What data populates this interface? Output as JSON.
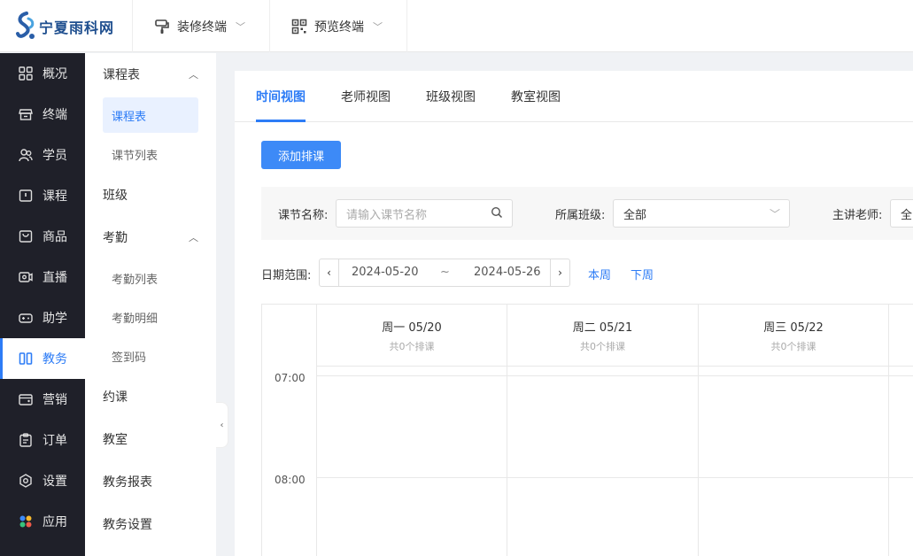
{
  "brand": {
    "name": "宁夏雨科网"
  },
  "topnav": [
    {
      "label": "装修终端",
      "icon": "brush-icon"
    },
    {
      "label": "预览终端",
      "icon": "qrcode-icon"
    }
  ],
  "sidebar": {
    "items": [
      {
        "label": "概况",
        "icon": "dashboard-icon"
      },
      {
        "label": "终端",
        "icon": "store-icon"
      },
      {
        "label": "学员",
        "icon": "users-icon"
      },
      {
        "label": "课程",
        "icon": "course-icon"
      },
      {
        "label": "商品",
        "icon": "goods-icon"
      },
      {
        "label": "直播",
        "icon": "live-icon"
      },
      {
        "label": "助学",
        "icon": "gamepad-icon"
      },
      {
        "label": "教务",
        "icon": "book-icon"
      },
      {
        "label": "营销",
        "icon": "wallet-icon"
      },
      {
        "label": "订单",
        "icon": "clipboard-icon"
      },
      {
        "label": "设置",
        "icon": "settings-icon"
      },
      {
        "label": "应用",
        "icon": "apps-icon"
      }
    ],
    "active": "教务"
  },
  "submenu": {
    "group_schedule": "课程表",
    "item_schedule": "课程表",
    "item_lessons": "课节列表",
    "class": "班级",
    "group_attendance": "考勤",
    "item_attendance_list": "考勤列表",
    "item_attendance_detail": "考勤明细",
    "item_checkin": "签到码",
    "appointment": "约课",
    "classroom": "教室",
    "report": "教务报表",
    "settings": "教务设置"
  },
  "tabs": [
    "时间视图",
    "老师视图",
    "班级视图",
    "教室视图"
  ],
  "active_tab": "时间视图",
  "toolbar": {
    "add_label": "添加排课"
  },
  "filters": {
    "lesson_label": "课节名称:",
    "lesson_placeholder": "请输入课节名称",
    "class_label": "所属班级:",
    "class_value": "全部",
    "teacher_label": "主讲老师:",
    "teacher_value": "全"
  },
  "date_range": {
    "label": "日期范围:",
    "start": "2024-05-20",
    "sep": "~",
    "end": "2024-05-26",
    "this_week": "本周",
    "next_week": "下周"
  },
  "calendar": {
    "days": [
      {
        "title": "周一 05/20",
        "count": "共0个排课"
      },
      {
        "title": "周二 05/21",
        "count": "共0个排课"
      },
      {
        "title": "周三 05/22",
        "count": "共0个排课"
      }
    ],
    "times": [
      "07:00",
      "08:00"
    ]
  },
  "colors": {
    "accent": "#2d7cf6",
    "sidebar_bg": "#1f2029"
  }
}
